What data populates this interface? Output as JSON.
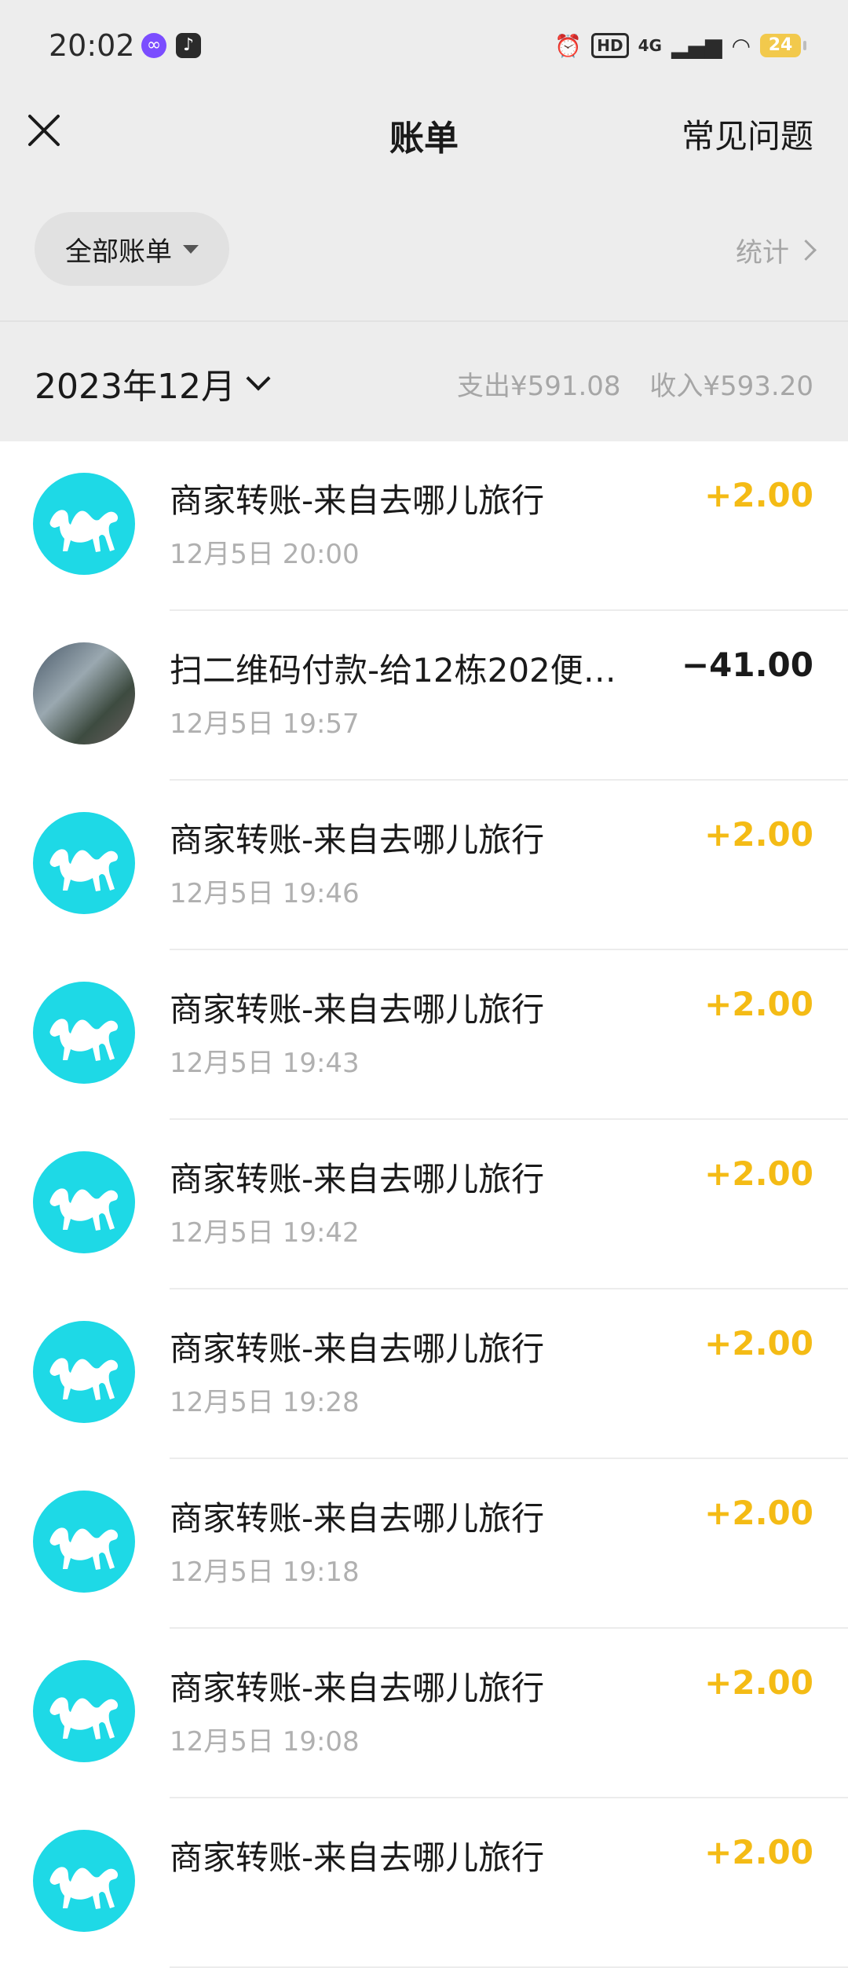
{
  "status_bar": {
    "time": "20:02",
    "hd": "HD",
    "network": "4G",
    "battery": "24"
  },
  "header": {
    "title": "账单",
    "faq_label": "常见问题"
  },
  "filter": {
    "all_bills_label": "全部账单",
    "stats_label": "统计"
  },
  "month": {
    "label": "2023年12月",
    "expense": "支出¥591.08",
    "income": "收入¥593.20"
  },
  "transactions": [
    {
      "title": "商家转账-来自去哪儿旅行",
      "time": "12月5日 20:00",
      "amount": "+2.00",
      "type": "income",
      "avatar": "camel-logo"
    },
    {
      "title": "扫二维码付款-给12栋202便…",
      "time": "12月5日 19:57",
      "amount": "−41.00",
      "type": "expense",
      "avatar": "shop-photo"
    },
    {
      "title": "商家转账-来自去哪儿旅行",
      "time": "12月5日 19:46",
      "amount": "+2.00",
      "type": "income",
      "avatar": "camel-logo"
    },
    {
      "title": "商家转账-来自去哪儿旅行",
      "time": "12月5日 19:43",
      "amount": "+2.00",
      "type": "income",
      "avatar": "camel-logo"
    },
    {
      "title": "商家转账-来自去哪儿旅行",
      "time": "12月5日 19:42",
      "amount": "+2.00",
      "type": "income",
      "avatar": "camel-logo"
    },
    {
      "title": "商家转账-来自去哪儿旅行",
      "time": "12月5日 19:28",
      "amount": "+2.00",
      "type": "income",
      "avatar": "camel-logo"
    },
    {
      "title": "商家转账-来自去哪儿旅行",
      "time": "12月5日 19:18",
      "amount": "+2.00",
      "type": "income",
      "avatar": "camel-logo"
    },
    {
      "title": "商家转账-来自去哪儿旅行",
      "time": "12月5日 19:08",
      "amount": "+2.00",
      "type": "income",
      "avatar": "camel-logo"
    },
    {
      "title": "商家转账-来自去哪儿旅行",
      "time": "",
      "amount": "+2.00",
      "type": "income",
      "avatar": "camel-logo"
    }
  ],
  "colors": {
    "income": "#f4bb15",
    "expense": "#1a1a1a",
    "avatar_bg": "#1ed9e6",
    "header_bg": "#ededed"
  }
}
